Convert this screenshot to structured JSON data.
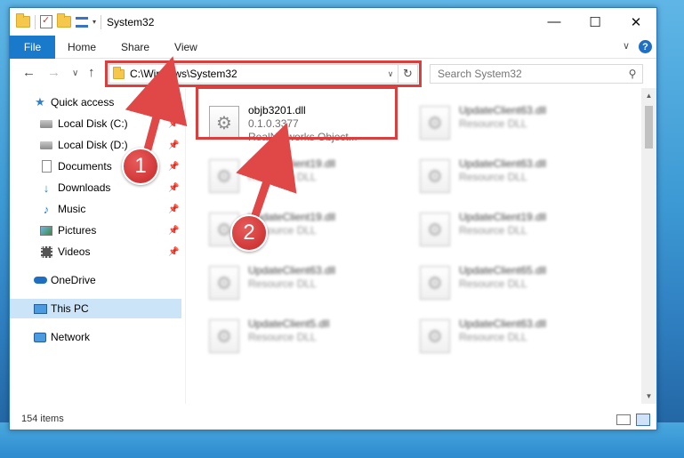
{
  "window": {
    "title": "System32"
  },
  "controls": {
    "minimize": "—",
    "maximize": "☐",
    "close": "✕"
  },
  "ribbon": {
    "tabs": [
      "File",
      "Home",
      "Share",
      "View"
    ],
    "help": "?"
  },
  "nav": {
    "back": "←",
    "forward": "→",
    "recent": "∨",
    "up": "↑",
    "address": "C:\\Windows\\System32",
    "search_placeholder": "Search System32"
  },
  "sidebar": {
    "items": [
      {
        "label": "Quick access",
        "icon": "star-icon"
      },
      {
        "label": "Local Disk (C:)",
        "icon": "disk-icon",
        "pinned": true
      },
      {
        "label": "Local Disk (D:)",
        "icon": "disk-icon",
        "pinned": true
      },
      {
        "label": "Documents",
        "icon": "documents-icon",
        "pinned": true
      },
      {
        "label": "Downloads",
        "icon": "downloads-icon",
        "pinned": true
      },
      {
        "label": "Music",
        "icon": "music-icon",
        "pinned": true
      },
      {
        "label": "Pictures",
        "icon": "pictures-icon",
        "pinned": true
      },
      {
        "label": "Videos",
        "icon": "videos-icon",
        "pinned": true
      },
      {
        "label": "OneDrive",
        "icon": "onedrive-icon"
      },
      {
        "label": "This PC",
        "icon": "this-pc-icon",
        "selected": true
      },
      {
        "label": "Network",
        "icon": "network-icon"
      }
    ]
  },
  "files": [
    {
      "name": "objb3201.dll",
      "line2": "0.1.0.3377",
      "line3": "RealNetworks Object...",
      "blurred": false
    },
    {
      "name": "UpdateClient63.dll",
      "line2": "Resource DLL",
      "blurred": true
    },
    {
      "name": "UpdateClient19.dll",
      "line2": "Resource DLL",
      "blurred": true
    },
    {
      "name": "UpdateClient63.dll",
      "line2": "Resource DLL",
      "blurred": true
    },
    {
      "name": "UpdateClient19.dll",
      "line2": "Resource DLL",
      "blurred": true
    },
    {
      "name": "UpdateClient19.dll",
      "line2": "Resource DLL",
      "blurred": true
    },
    {
      "name": "UpdateClient63.dll",
      "line2": "Resource DLL",
      "blurred": true
    },
    {
      "name": "UpdateClient65.dll",
      "line2": "Resource DLL",
      "blurred": true
    },
    {
      "name": "UpdateClient5.dll",
      "line2": "Resource DLL",
      "blurred": true
    },
    {
      "name": "UpdateClient63.dll",
      "line2": "Resource DLL",
      "blurred": true
    }
  ],
  "status": {
    "item_count": "154 items"
  },
  "annotations": {
    "step1": "1",
    "step2": "2",
    "highlight_color": "#dc3d3d"
  }
}
